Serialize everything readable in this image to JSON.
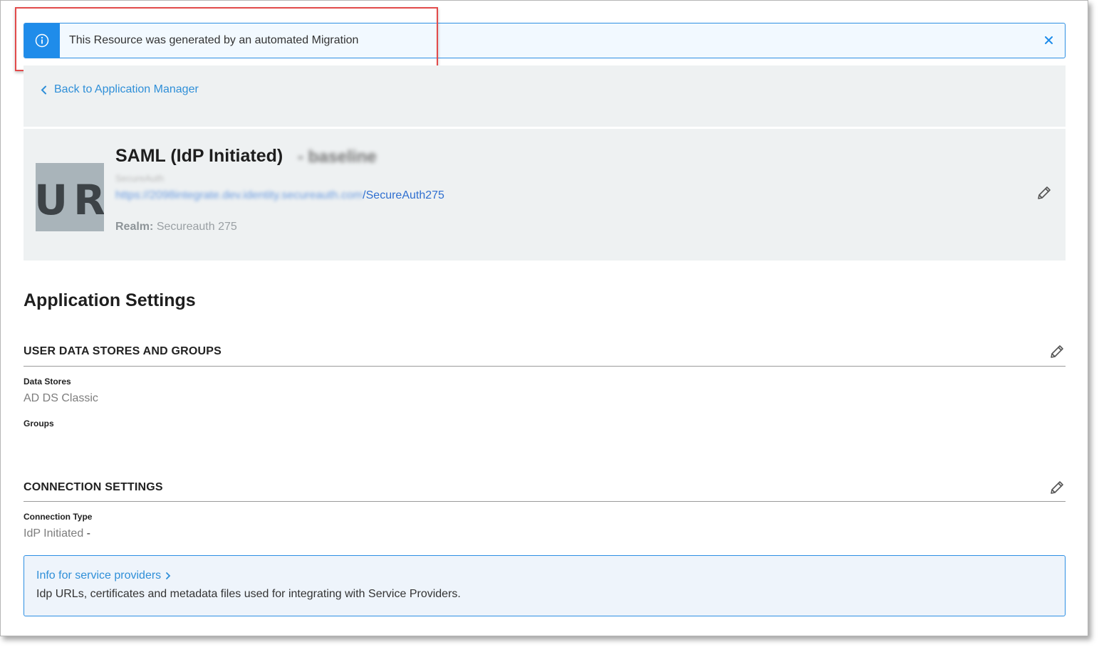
{
  "banner": {
    "message": "This Resource was generated by an automated Migration",
    "info_icon": "info-circle-icon",
    "close_icon": "close-icon",
    "accent_color": "#1f8cea",
    "highlight_color": "#e24a4a"
  },
  "nav": {
    "back_label": "Back to Application Manager",
    "back_icon": "chevron-left-icon"
  },
  "app": {
    "logo_text": "UR",
    "title": "SAML (IdP Initiated)",
    "title_suffix_blurred": "- baseline",
    "subtitle_blurred": "SecureAuth",
    "url_blurred": "https://2098integrate.dev.identity.secureauth.com",
    "url_suffix": "/SecureAuth275",
    "realm_label": "Realm:",
    "realm_value": "Secureauth 275",
    "edit_icon": "pencil-icon"
  },
  "settings": {
    "heading": "Application Settings",
    "user_data": {
      "title": "USER DATA STORES AND GROUPS",
      "data_stores_label": "Data Stores",
      "data_stores_value": "AD DS Classic",
      "groups_label": "Groups",
      "groups_value": ""
    },
    "connection": {
      "title": "CONNECTION SETTINGS",
      "type_label": "Connection Type",
      "type_value": "IdP Initiated",
      "type_suffix": "-"
    },
    "info": {
      "link_label": "Info for service providers",
      "link_icon": "chevron-right-icon",
      "description": "Idp URLs, certificates and metadata files used for integrating with Service Providers."
    }
  }
}
